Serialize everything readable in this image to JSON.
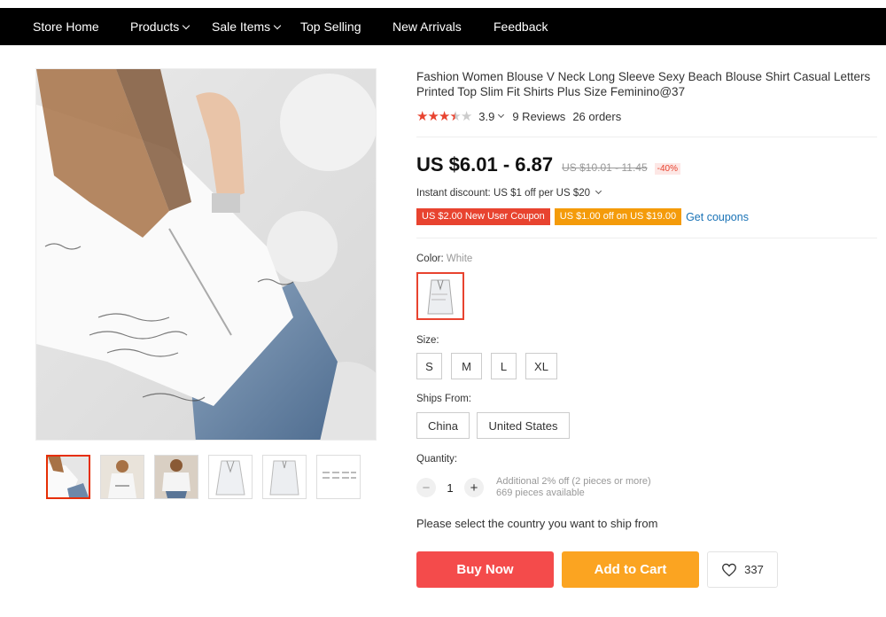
{
  "nav": {
    "items": [
      {
        "label": "Store Home",
        "dropdown": false
      },
      {
        "label": "Products",
        "dropdown": true
      },
      {
        "label": "Sale Items",
        "dropdown": true
      },
      {
        "label": "Top Selling",
        "dropdown": false
      },
      {
        "label": "New Arrivals",
        "dropdown": false
      },
      {
        "label": "Feedback",
        "dropdown": false
      }
    ]
  },
  "product": {
    "title": "Fashion Women Blouse V Neck Long Sleeve Sexy Beach Blouse Shirt Casual Letters Printed Top Slim Fit Shirts Plus Size Feminino@37",
    "rating_value": "3.9",
    "rating_fraction": 0.78,
    "reviews": "9 Reviews",
    "orders": "26 orders",
    "price": "US $6.01 - 6.87",
    "old_price": "US $10.01 - 11.45",
    "discount": "-40%",
    "instant_discount": "Instant discount: US $1 off per US $20",
    "coupons": [
      "US $2.00 New User Coupon",
      "US $1.00 off on US $19.00"
    ],
    "get_coupons": "Get coupons",
    "color_label": "Color:",
    "color_value": "White",
    "size_label": "Size:",
    "sizes": [
      "S",
      "M",
      "L",
      "XL"
    ],
    "ships_label": "Ships From:",
    "ships_options": [
      "China",
      "United States"
    ],
    "quantity_label": "Quantity:",
    "quantity_value": "1",
    "quantity_minus": "−",
    "quantity_plus": "+",
    "qty_info_1": "Additional 2% off (2 pieces or more)",
    "qty_info_2": "669 pieces available",
    "ship_message": "Please select the country you want to ship from",
    "buy_now": "Buy Now",
    "add_to_cart": "Add to Cart",
    "wishlist_count": "337"
  },
  "colors": {
    "accent_red": "#e8432f",
    "buy_now": "#f44b4b",
    "add_to_cart": "#fba421",
    "coupon_orange": "#f49b0a",
    "link_blue": "#1a73b6"
  },
  "icons": {
    "chevron": "chevron-down-icon",
    "heart": "heart-icon",
    "star": "star-icon"
  }
}
